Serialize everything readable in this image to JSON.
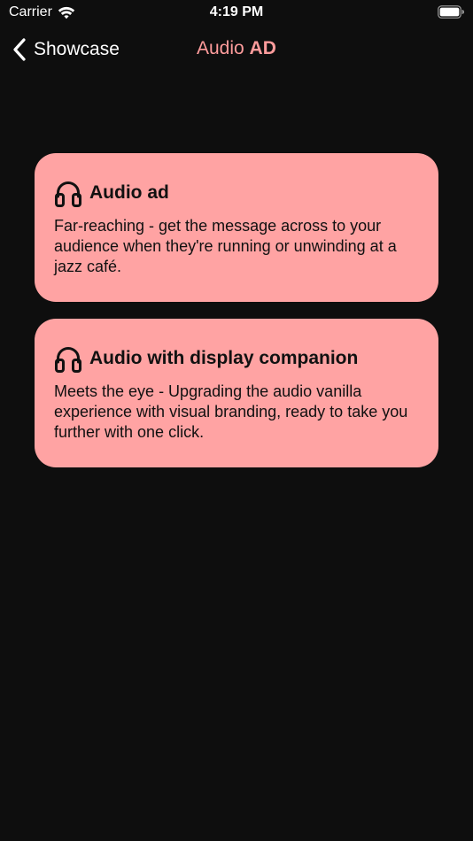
{
  "status_bar": {
    "carrier": "Carrier",
    "time": "4:19 PM",
    "wifi_icon": "wifi-icon",
    "battery_icon": "battery-icon"
  },
  "nav": {
    "back_label": "Showcase",
    "title_regular": "Audio ",
    "title_bold": "AD",
    "title_color": "#ff9c9c"
  },
  "cards": [
    {
      "icon": "headphones-icon",
      "title": "Audio ad",
      "description": "Far-reaching - get the message across to your audience when they're running or unwinding at a jazz café."
    },
    {
      "icon": "headphones-icon",
      "title": "Audio with display companion",
      "description": "Meets the eye - Upgrading the audio vanilla experience with visual branding, ready to take you further with one click."
    }
  ],
  "colors": {
    "background": "#0e0e0e",
    "card_background": "#ffa3a3",
    "card_text": "#111111",
    "accent": "#ff9c9c"
  }
}
